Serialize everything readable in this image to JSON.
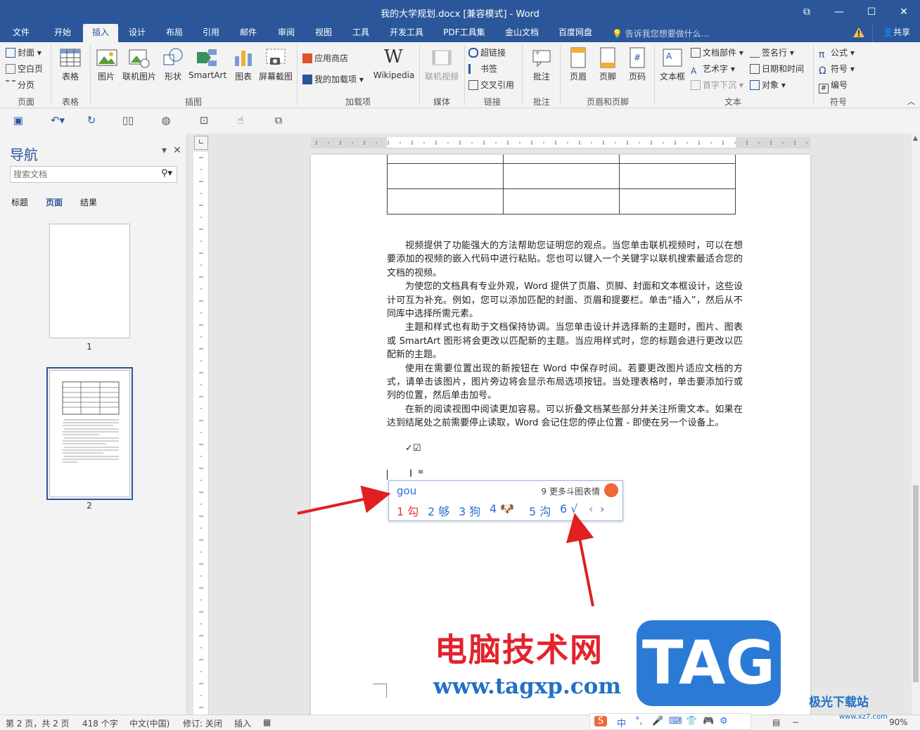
{
  "window": {
    "title": "我的大学规划.docx [兼容模式] - Word",
    "controls": [
      "⧉",
      "—",
      "☐",
      "✕"
    ]
  },
  "tabs": [
    "文件",
    "开始",
    "插入",
    "设计",
    "布局",
    "引用",
    "邮件",
    "审阅",
    "视图",
    "工具",
    "开发工具",
    "PDF工具集",
    "金山文档",
    "百度网盘"
  ],
  "active_tab": "插入",
  "tell_me": "告诉我您想要做什么...",
  "share_label": "共享",
  "ribbon": {
    "pages": {
      "items": [
        "封面",
        "空白页",
        "分页"
      ],
      "label": "页面"
    },
    "tables": {
      "button": "表格",
      "label": "表格"
    },
    "illustrations": {
      "items": [
        "图片",
        "联机图片",
        "形状",
        "SmartArt",
        "图表",
        "屏幕截图"
      ],
      "label": "插图"
    },
    "addins": {
      "items": [
        "应用商店",
        "我的加载项"
      ],
      "wiki": "Wikipedia",
      "label": "加载项"
    },
    "media": {
      "button": "联机视频",
      "label": "媒体"
    },
    "links": {
      "items": [
        "超链接",
        "书签",
        "交叉引用"
      ],
      "label": "链接"
    },
    "comments": {
      "button": "批注",
      "label": "批注"
    },
    "header_footer": {
      "items": [
        "页眉",
        "页脚",
        "页码"
      ],
      "label": "页眉和页脚"
    },
    "text": {
      "textbox": "文本框",
      "items": [
        "文档部件",
        "艺术字",
        "首字下沉"
      ],
      "items2": [
        "签名行",
        "日期和时间",
        "对象"
      ],
      "label": "文本"
    },
    "symbols": {
      "items": [
        "公式",
        "符号",
        "编号"
      ],
      "label": "符号"
    }
  },
  "nav": {
    "title": "导航",
    "search_placeholder": "搜索文档",
    "tabs": [
      "标题",
      "页面",
      "结果"
    ],
    "active_tab": "页面",
    "pages": [
      "1",
      "2"
    ]
  },
  "document": {
    "paragraphs": [
      "视频提供了功能强大的方法帮助您证明您的观点。当您单击联机视频时，可以在想要添加的视频的嵌入代码中进行粘贴。您也可以键入一个关键字以联机搜索最适合您的文档的视频。",
      "为使您的文档具有专业外观，Word 提供了页眉、页脚、封面和文本框设计，这些设计可互为补充。例如，您可以添加匹配的封面、页眉和提要栏。单击“插入”，然后从不同库中选择所需元素。",
      "主题和样式也有助于文档保持协调。当您单击设计并选择新的主题时，图片、图表或 SmartArt 图形将会更改以匹配新的主题。当应用样式时，您的标题会进行更改以匹配新的主题。",
      "使用在需要位置出现的新按钮在 Word 中保存时间。若要更改图片适应文档的方式，请单击该图片，图片旁边将会显示布局选项按钮。当处理表格时，单击要添加行或列的位置，然后单击加号。",
      "在新的阅读视图中阅读更加容易。可以折叠文档某些部分并关注所需文本。如果在达到结尾处之前需要停止读取，Word 会记住您的停止位置 - 即使在另一个设备上。"
    ],
    "checkmarks": "✓☑"
  },
  "ime": {
    "input": "gou",
    "more": "9 更多斗图表情",
    "candidates": [
      "1 勾",
      "2 够",
      "3 狗",
      "4 🐶",
      "5 沟",
      "6 √"
    ],
    "nav": [
      "‹",
      "›"
    ]
  },
  "watermark": {
    "cn": "电脑技术网",
    "url": "www.tagxp.com",
    "tag": "TAG"
  },
  "statusbar": {
    "page": "第 2 页，共 2 页",
    "words": "418 个字",
    "lang": "中文(中国)",
    "revisions": "修订: 关闭",
    "mode": "插入",
    "zoom": "90%"
  },
  "imebar": {
    "items": [
      "S",
      "中",
      "°,",
      "🎤",
      "⌨",
      "👕",
      "🎮",
      "⚙"
    ]
  },
  "site": {
    "logo": "极光下载站",
    "url": "www.xz7.com"
  },
  "colors": {
    "accent": "#2b579a",
    "ime_blue": "#2b6fd6",
    "arrow": "#e02020"
  }
}
